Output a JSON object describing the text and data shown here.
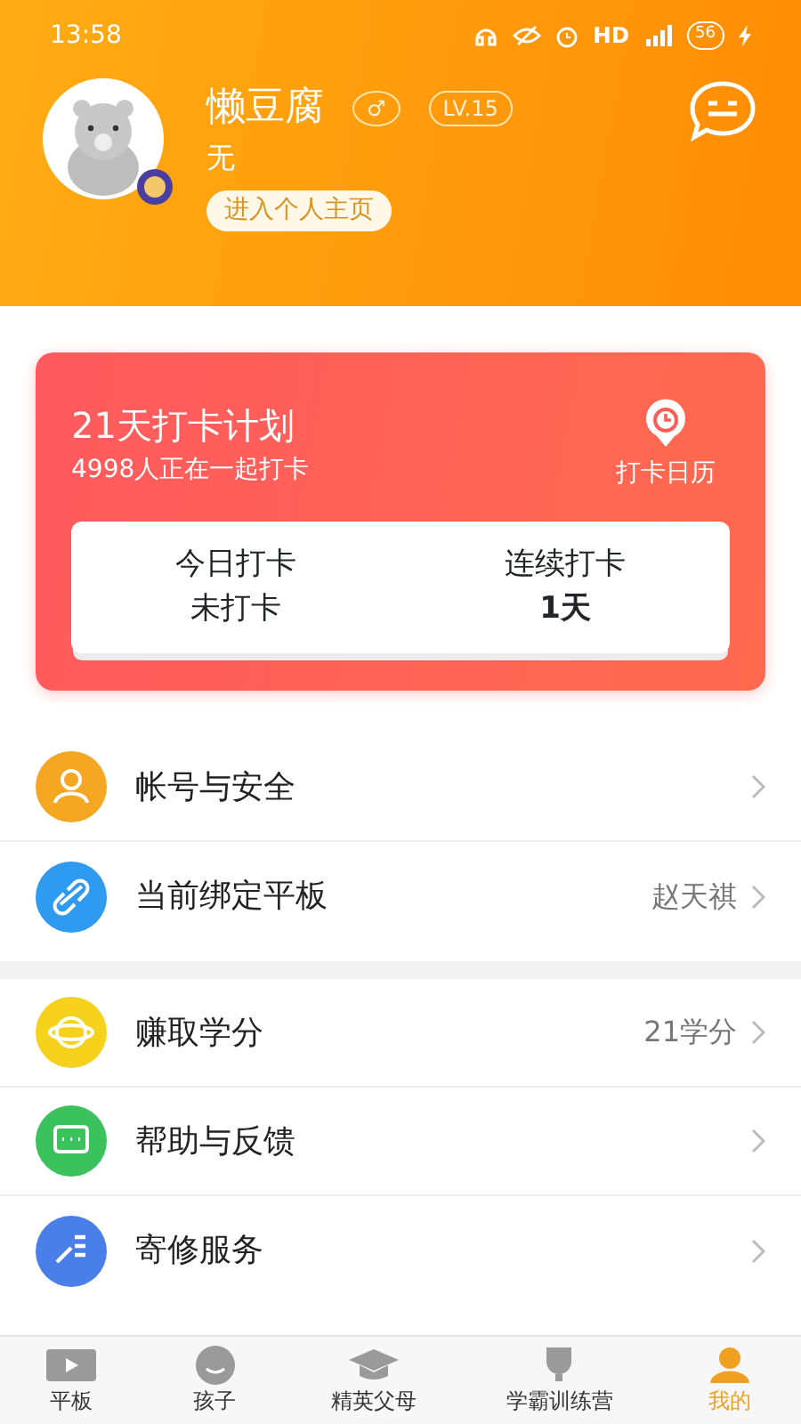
{
  "status_bar": {
    "time": "13:58",
    "network": "HD",
    "battery": "56"
  },
  "profile": {
    "name": "懒豆腐",
    "gender": "♂",
    "level": "LV.15",
    "bio": "无",
    "home_button": "进入个人主页"
  },
  "checkin": {
    "title": "21天打卡计划",
    "subtitle": "4998人正在一起打卡",
    "calendar": "打卡日历",
    "stats": [
      {
        "label": "今日打卡",
        "value": "未打卡"
      },
      {
        "label": "连续打卡",
        "value": "1天"
      }
    ]
  },
  "menu_groups": [
    [
      {
        "kind": "account",
        "label": "帐号与安全",
        "color": "#f5a623"
      },
      {
        "kind": "link",
        "label": "当前绑定平板",
        "value": "赵天祺",
        "color": "#2f9bf0"
      }
    ],
    [
      {
        "kind": "points",
        "label": "赚取学分",
        "value": "21学分",
        "color": "#f7d21c"
      },
      {
        "kind": "help",
        "label": "帮助与反馈",
        "color": "#3cc25c"
      },
      {
        "kind": "repair",
        "label": "寄修服务",
        "color": "#4a7ee8"
      }
    ]
  ],
  "tabs": [
    {
      "kind": "tablet",
      "label": "平板",
      "selected": false
    },
    {
      "kind": "child",
      "label": "孩子",
      "selected": false
    },
    {
      "kind": "parent",
      "label": "精英父母",
      "selected": false
    },
    {
      "kind": "camp",
      "label": "学霸训练营",
      "selected": false
    },
    {
      "kind": "me",
      "label": "我的",
      "selected": true
    }
  ]
}
